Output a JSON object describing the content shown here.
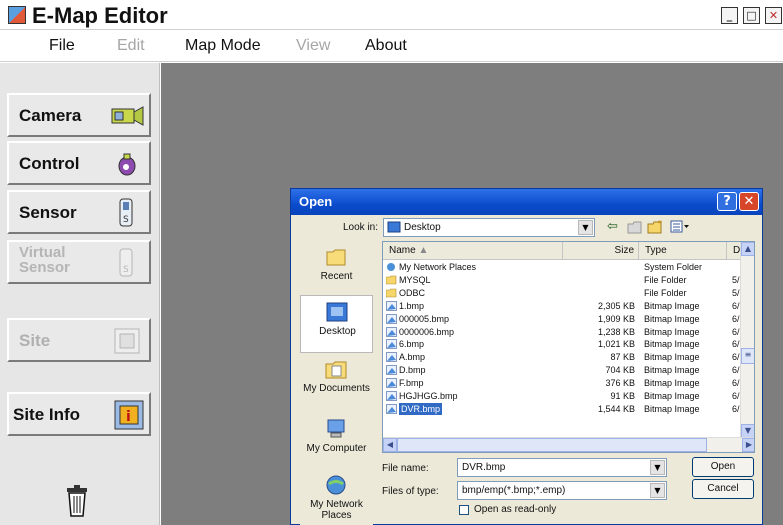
{
  "app": {
    "title": "E-Map Editor"
  },
  "menu": {
    "items": [
      {
        "label": "File",
        "enabled": true
      },
      {
        "label": "Edit",
        "enabled": false
      },
      {
        "label": "Map Mode",
        "enabled": true
      },
      {
        "label": "View",
        "enabled": false
      },
      {
        "label": "About",
        "enabled": true
      }
    ]
  },
  "toolbar": {
    "camera": "Camera",
    "control": "Control",
    "sensor": "Sensor",
    "virtual_sensor_line1": "Virtual",
    "virtual_sensor_line2": "Sensor",
    "site": "Site",
    "site_info": "Site Info"
  },
  "dialog": {
    "title": "Open",
    "look_in_label": "Look in:",
    "look_in_value": "Desktop",
    "places": [
      "Recent",
      "Desktop",
      "My Documents",
      "My Computer",
      "My Network Places"
    ],
    "columns": [
      "Name",
      "Size",
      "Type",
      "Date"
    ],
    "files": [
      {
        "name": "My Network Places",
        "size": "",
        "type": "System Folder",
        "date": "",
        "icon": "network-icon"
      },
      {
        "name": "MYSQL",
        "size": "",
        "type": "File Folder",
        "date": "5/28/",
        "icon": "folder-icon"
      },
      {
        "name": "ODBC",
        "size": "",
        "type": "File Folder",
        "date": "5/28/",
        "icon": "folder-icon"
      },
      {
        "name": "1.bmp",
        "size": "2,305 KB",
        "type": "Bitmap Image",
        "date": "6/7/2",
        "icon": "bitmap-icon"
      },
      {
        "name": "000005.bmp",
        "size": "1,909 KB",
        "type": "Bitmap Image",
        "date": "6/12/",
        "icon": "bitmap-icon"
      },
      {
        "name": "0000006.bmp",
        "size": "1,238 KB",
        "type": "Bitmap Image",
        "date": "6/12/",
        "icon": "bitmap-icon"
      },
      {
        "name": "6.bmp",
        "size": "1,021 KB",
        "type": "Bitmap Image",
        "date": "6/7/2",
        "icon": "bitmap-icon"
      },
      {
        "name": "A.bmp",
        "size": "87 KB",
        "type": "Bitmap Image",
        "date": "6/12/",
        "icon": "bitmap-icon"
      },
      {
        "name": "D.bmp",
        "size": "704 KB",
        "type": "Bitmap Image",
        "date": "6/12/",
        "icon": "bitmap-icon"
      },
      {
        "name": "F.bmp",
        "size": "376 KB",
        "type": "Bitmap Image",
        "date": "6/12/",
        "icon": "bitmap-icon"
      },
      {
        "name": "HGJHGG.bmp",
        "size": "91 KB",
        "type": "Bitmap Image",
        "date": "6/12/",
        "icon": "bitmap-icon"
      },
      {
        "name": "DVR.bmp",
        "size": "1,544 KB",
        "type": "Bitmap Image",
        "date": "6/12/",
        "icon": "bitmap-icon",
        "selected": true
      }
    ],
    "file_name_label": "File name:",
    "file_name_value": "DVR.bmp",
    "file_type_label": "Files of type:",
    "file_type_value": "bmp/emp(*.bmp;*.emp)",
    "open_button": "Open",
    "cancel_button": "Cancel",
    "readonly_label": "Open as read-only"
  },
  "colors": {
    "canvas": "#7e7e7e",
    "dialog_title": "#0a4ccc",
    "selection": "#316ac5"
  }
}
